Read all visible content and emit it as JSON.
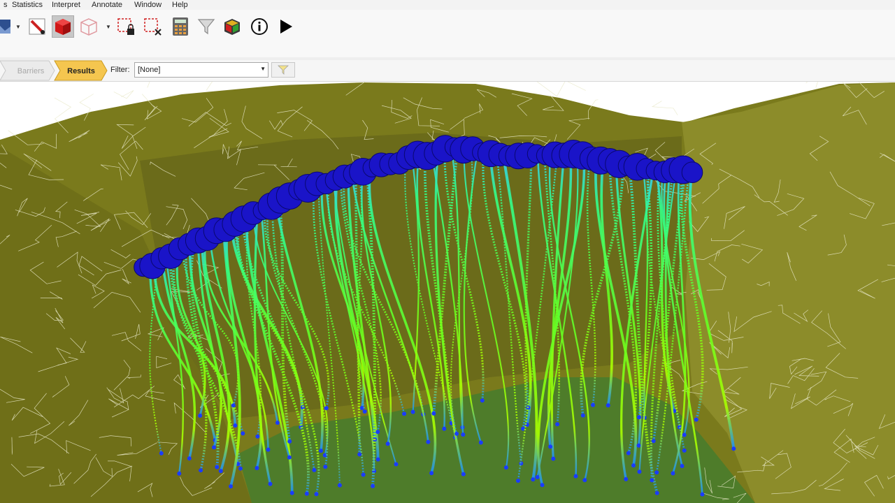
{
  "menu": {
    "items": [
      "s",
      "Statistics",
      "Interpret",
      "Annotate",
      "Window",
      "Help"
    ]
  },
  "toolbar": {
    "icons": [
      "image-icon",
      "pen-edit-icon",
      "red-cube-icon",
      "cube-outline-icon",
      "select-lock-icon",
      "select-clear-icon",
      "calculator-icon",
      "filter-icon",
      "3d-box-icon",
      "info-icon",
      "play-icon"
    ]
  },
  "breadcrumb": {
    "steps": [
      "Barriers",
      "Results"
    ],
    "active": "Results"
  },
  "filter": {
    "label": "Filter:",
    "value": "[None]"
  },
  "colors": {
    "active_step": "#f5c64f",
    "terrain": "#7a7a1c",
    "terrain_light": "#96963a",
    "floor": "#4e7c2a",
    "source": "#1a14c8"
  }
}
